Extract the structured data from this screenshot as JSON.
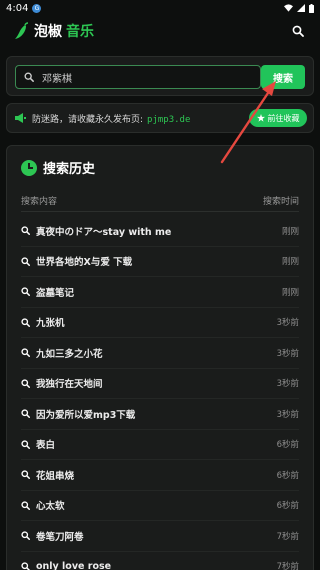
{
  "status": {
    "time": "4:04",
    "notif": "G"
  },
  "app": {
    "name_white": "泡椒",
    "name_green": "音乐"
  },
  "search": {
    "value": "邓紫棋",
    "button": "搜索"
  },
  "notice": {
    "text": "防迷路，请收藏永久发布页:",
    "domain": "pjmp3.de",
    "button": "前往收藏"
  },
  "history": {
    "title": "搜索历史",
    "col_content": "搜索内容",
    "col_time": "搜索时间",
    "items": [
      {
        "query": "真夜中のドア〜stay with me",
        "time": "刚刚"
      },
      {
        "query": "世界各地的X与爱 下载",
        "time": "刚刚"
      },
      {
        "query": "盗墓笔记",
        "time": "刚刚"
      },
      {
        "query": "九张机",
        "time": "3秒前"
      },
      {
        "query": "九如三多之小花",
        "time": "3秒前"
      },
      {
        "query": "我独行在天地间",
        "time": "3秒前"
      },
      {
        "query": "因为爱所以爱mp3下载",
        "time": "3秒前"
      },
      {
        "query": "表白",
        "time": "6秒前"
      },
      {
        "query": "花姐串烧",
        "time": "6秒前"
      },
      {
        "query": "心太软",
        "time": "6秒前"
      },
      {
        "query": "卷笔刀阿卷",
        "time": "7秒前"
      },
      {
        "query": "only love rose",
        "time": "7秒前"
      }
    ]
  },
  "colors": {
    "accent": "#21c45a",
    "background": "#0d0f0e",
    "card": "#1a1c1b",
    "arrow": "#e5483f"
  }
}
